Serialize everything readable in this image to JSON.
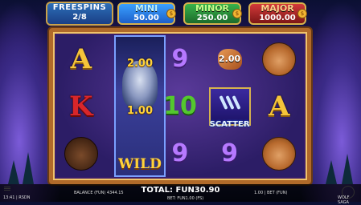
{
  "freespins": {
    "label": "FREESPINS",
    "value": "2/8"
  },
  "jackpots": [
    {
      "name": "MINI",
      "value": "50.00"
    },
    {
      "name": "MINOR",
      "value": "250.00"
    },
    {
      "name": "MAJOR",
      "value": "1000.00"
    }
  ],
  "reels": {
    "col1": [
      "A",
      "K",
      "bison"
    ],
    "col2": {
      "multipliers": [
        "2.00",
        "1.00"
      ],
      "wild_label": "WILD"
    },
    "col3": [
      "9",
      "10",
      "9"
    ],
    "col4": {
      "top_multiplier": "2.00",
      "scatter_label": "SCATTER",
      "bottom": "9"
    },
    "col5": [
      "cougar",
      "A",
      "cougar"
    ]
  },
  "bottom_bar": {
    "time": "13:41 | RSDN",
    "balance": "BALANCE (FUN) 4344.15",
    "total_win": "TOTAL: FUN30.90",
    "bet_sub": "BET: FUN1.00 (FS)",
    "bet_right": "1.00 | BET (FUN)",
    "game_name": "WOLF SAGA"
  },
  "colors": {
    "frame": "#b06a2a",
    "accent_gold": "#f5c43a"
  }
}
